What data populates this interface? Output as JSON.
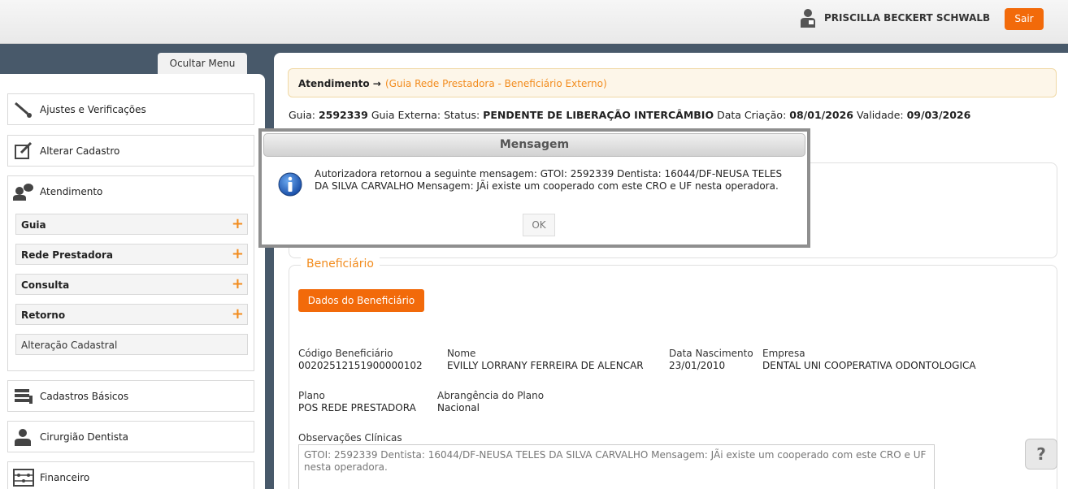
{
  "header": {
    "user_name": "PRISCILLA BECKERT SCHWALB",
    "logout_label": "Sair"
  },
  "sidebar": {
    "hide_menu_label": "Ocultar Menu",
    "items": [
      {
        "label": "Ajustes e Verificações",
        "icon": "wrench-icon"
      },
      {
        "label": "Alterar Cadastro",
        "icon": "edit-icon"
      },
      {
        "label": "Atendimento",
        "icon": "user-chat-icon"
      },
      {
        "label": "Cadastros Básicos",
        "icon": "list-icon"
      },
      {
        "label": "Cirurgião Dentista",
        "icon": "user-icon"
      },
      {
        "label": "Financeiro",
        "icon": "abacus-icon"
      }
    ],
    "atendimento_sub": [
      {
        "label": "Guia"
      },
      {
        "label": "Rede Prestadora"
      },
      {
        "label": "Consulta"
      },
      {
        "label": "Retorno"
      },
      {
        "label": "Alteração Cadastral"
      }
    ]
  },
  "breadcrumb": {
    "main": "Atendimento →",
    "link": "(Guia Rede Prestadora - Beneficiário Externo)"
  },
  "guide": {
    "guia_label": "Guia:",
    "guia_value": "2592339",
    "externa_label": "Guia Externa:",
    "status_label": "Status:",
    "status_value": "PENDENTE DE LIBERAÇÃO INTERCÂMBIO",
    "criacao_label": "Data Criação:",
    "criacao_value": "08/01/2026",
    "validade_label": "Validade:",
    "validade_value": "09/03/2026"
  },
  "beneficiario": {
    "legend": "Beneficiário",
    "dados_button": "Dados do Beneficiário",
    "codigo_label": "Código Beneficiário",
    "codigo_value": "00202512151900000102",
    "nome_label": "Nome",
    "nome_value": "EVILLY LORRANY FERREIRA DE ALENCAR",
    "nascimento_label": "Data Nascimento",
    "nascimento_value": "23/01/2010",
    "empresa_label": "Empresa",
    "empresa_value": "DENTAL UNI COOPERATIVA ODONTOLOGICA",
    "plano_label": "Plano",
    "plano_value": "POS REDE PRESTADORA",
    "abrangencia_label": "Abrangência do Plano",
    "abrangencia_value": "Nacional",
    "obs_label": "Observações Clínicas",
    "obs_value": "GTOI: 2592339 Dentista: 16044/DF-NEUSA TELES DA SILVA CARVALHO Mensagem: JÃi existe um cooperado com este CRO e UF nesta operadora."
  },
  "dialog": {
    "title": "Mensagem",
    "message": "Autorizadora retornou a seguinte mensagem: GTOI: 2592339 Dentista: 16044/DF-NEUSA TELES DA SILVA CARVALHO Mensagem: JÃi existe um cooperado com este CRO e UF nesta operadora.",
    "ok_label": "OK"
  },
  "help_label": "?",
  "colors": {
    "accent": "#f26a0a",
    "link": "#f28c1e",
    "background": "#48596a"
  }
}
